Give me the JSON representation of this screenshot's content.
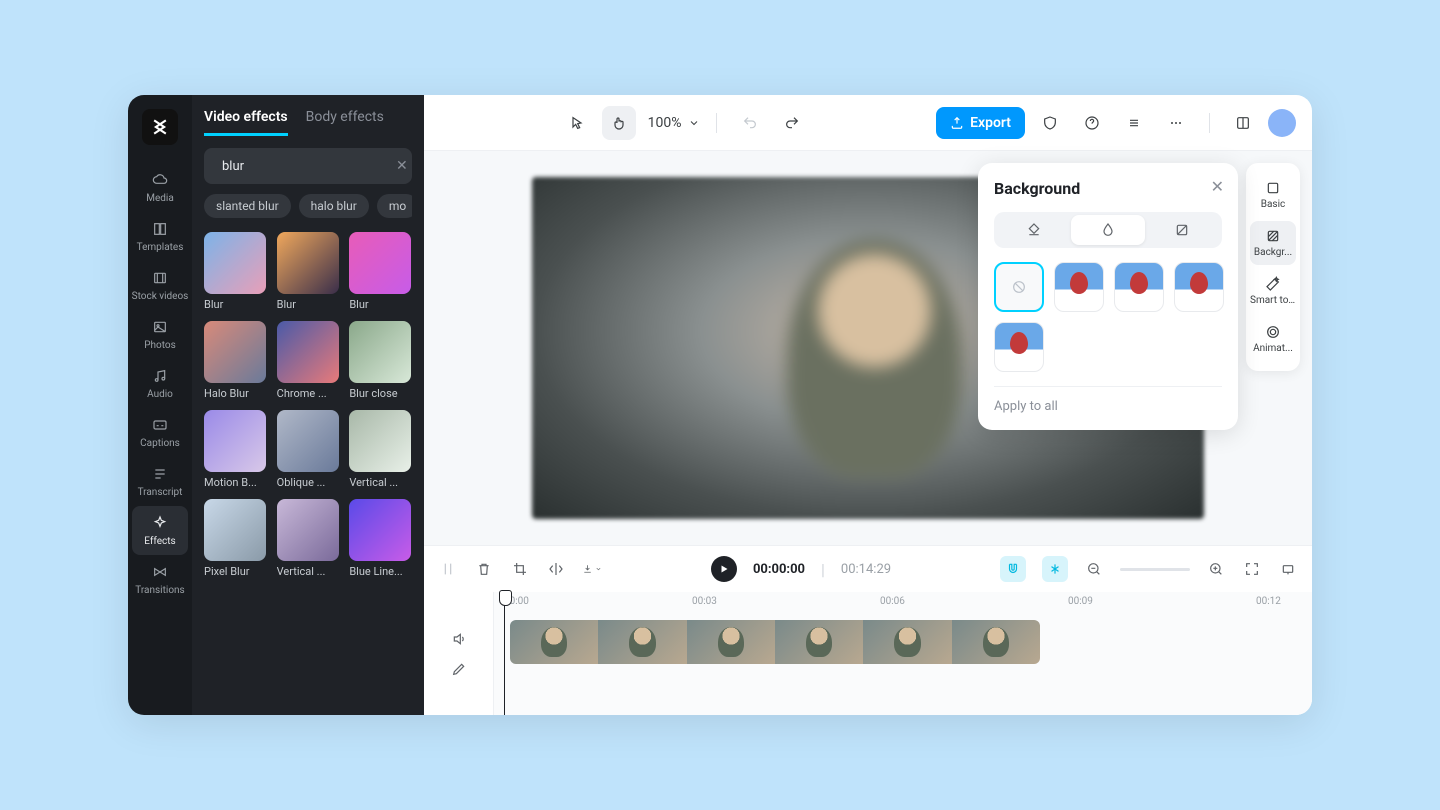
{
  "nav": {
    "items": [
      {
        "label": "Media"
      },
      {
        "label": "Templates"
      },
      {
        "label": "Stock videos"
      },
      {
        "label": "Photos"
      },
      {
        "label": "Audio"
      },
      {
        "label": "Captions"
      },
      {
        "label": "Transcript"
      },
      {
        "label": "Effects"
      },
      {
        "label": "Transitions"
      }
    ],
    "active": 7
  },
  "panel": {
    "tabs": [
      "Video effects",
      "Body effects"
    ],
    "search_value": "blur",
    "chips": [
      "slanted blur",
      "halo blur",
      "mo"
    ],
    "items": [
      {
        "label": "Blur"
      },
      {
        "label": "Blur"
      },
      {
        "label": "Blur"
      },
      {
        "label": "Halo Blur"
      },
      {
        "label": "Chrome ..."
      },
      {
        "label": "Blur close"
      },
      {
        "label": "Motion B..."
      },
      {
        "label": "Oblique ..."
      },
      {
        "label": "Vertical ..."
      },
      {
        "label": "Pixel Blur"
      },
      {
        "label": "Vertical ..."
      },
      {
        "label": "Blue Line..."
      }
    ]
  },
  "topbar": {
    "zoom": "100%",
    "export": "Export"
  },
  "rail": {
    "items": [
      "Basic",
      "Backgr...",
      "Smart tools",
      "Animat..."
    ],
    "active": 1
  },
  "popover": {
    "title": "Background",
    "apply": "Apply to all"
  },
  "timeline": {
    "current": "00:00:00",
    "duration": "00:14:29",
    "marks": [
      "00:00",
      "00:03",
      "00:06",
      "00:09",
      "00:12"
    ]
  }
}
